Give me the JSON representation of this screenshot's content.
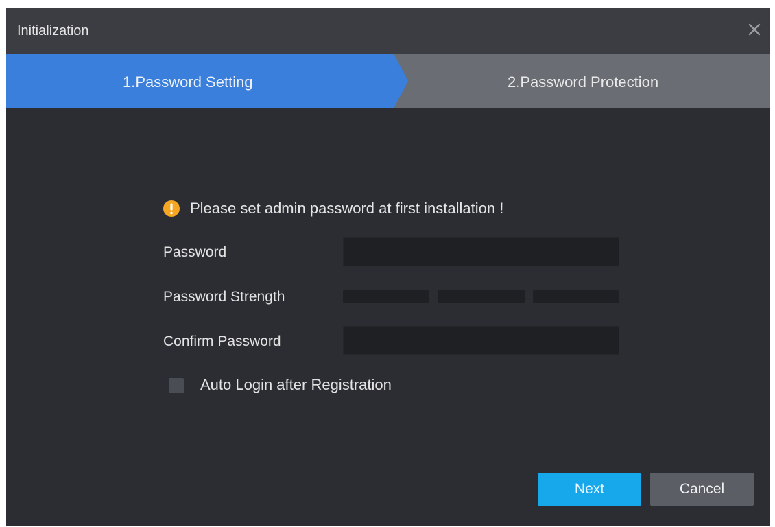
{
  "window": {
    "title": "Initialization",
    "close_icon": "close-icon"
  },
  "steps": [
    {
      "label": "1.Password Setting",
      "active": true
    },
    {
      "label": "2.Password Protection",
      "active": false
    }
  ],
  "colors": {
    "active_step": "#3a7fdb",
    "inactive_step": "#6a6d73",
    "primary_button": "#17a8ec",
    "warning_icon": "#f5a623",
    "dialog_background": "#2b2d32"
  },
  "form": {
    "notice_icon": "warning-icon",
    "notice": "Please set admin password at first installation !",
    "password_label": "Password",
    "password_value": "",
    "strength_label": "Password Strength",
    "strength_level": 0,
    "strength_segments": 3,
    "confirm_label": "Confirm Password",
    "confirm_value": "",
    "auto_login_label": "Auto Login after Registration",
    "auto_login_checked": false
  },
  "buttons": {
    "next": "Next",
    "cancel": "Cancel"
  }
}
